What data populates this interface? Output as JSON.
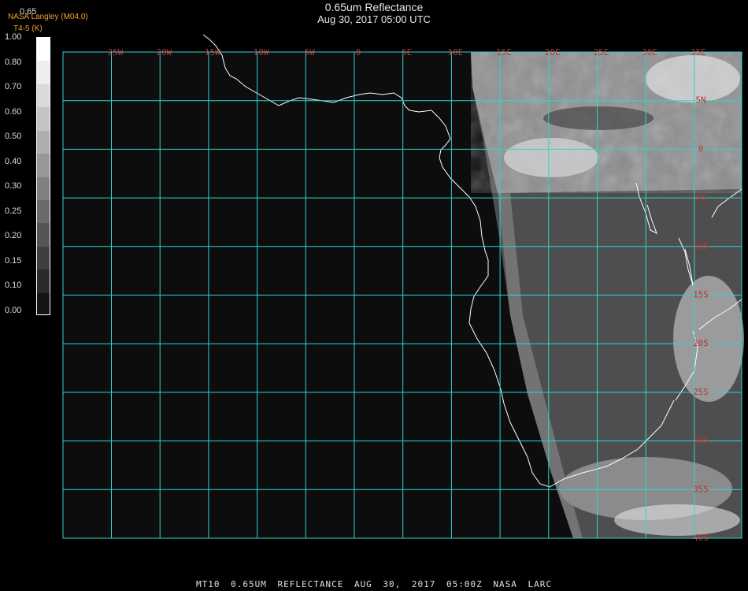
{
  "header": {
    "title": "0.65um Reflectance",
    "subtitle": "Aug 30, 2017 05:00 UTC",
    "credit": "NASA Langley (M04.0)",
    "product": "T4-5 (K)",
    "top_value": "0.65"
  },
  "legend": {
    "labels": [
      "1.00",
      "0.80",
      "0.70",
      "0.60",
      "0.50",
      "0.40",
      "0.30",
      "0.25",
      "0.20",
      "0.15",
      "0.10",
      "0.00"
    ],
    "colors": [
      "#ffffff",
      "#ededed",
      "#d9d9d9",
      "#c4c4c4",
      "#adadad",
      "#979797",
      "#808080",
      "#6a6a6a",
      "#555555",
      "#3f3f3f",
      "#2a2a2a",
      "#141414"
    ]
  },
  "map": {
    "lon_labels": [
      "25W",
      "20W",
      "15W",
      "10W",
      "5W",
      "0",
      "5E",
      "10E",
      "15E",
      "20E",
      "25E",
      "30E",
      "35E"
    ],
    "lat_labels": [
      "5N",
      "0",
      "5S",
      "10S",
      "15S",
      "20S",
      "25S",
      "30S",
      "35S",
      "40S"
    ],
    "grid_color": "#2fd4d4",
    "label_color": "#d42a2a",
    "space_color": "#0d0d0d"
  },
  "footer": {
    "text": "MT10  0.65UM REFLECTANCE   AUG 30, 2017 05:00Z   NASA LARC"
  }
}
